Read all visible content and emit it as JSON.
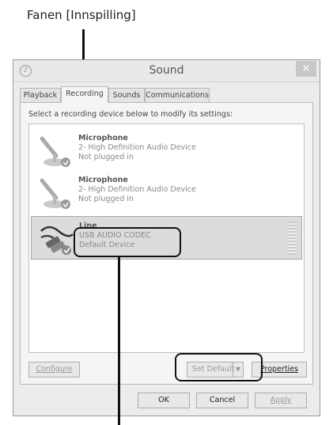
{
  "callout": {
    "tab_label": "Fanen [Innspilling]"
  },
  "window": {
    "title": "Sound",
    "close_glyph": "×"
  },
  "tabs": [
    {
      "label": "Playback"
    },
    {
      "label": "Recording"
    },
    {
      "label": "Sounds"
    },
    {
      "label": "Communications"
    }
  ],
  "instruction": "Select a recording device below to modify its settings:",
  "devices": [
    {
      "name": "Microphone",
      "line1": "2- High Definition Audio Device",
      "line2": "Not plugged in",
      "icon": "microphone-icon"
    },
    {
      "name": "Microphone",
      "line1": "2- High Definition Audio Device",
      "line2": "Not plugged in",
      "icon": "microphone-icon"
    },
    {
      "name": "Line",
      "line1": "USB AUDIO  CODEC",
      "line2": "Default Device",
      "icon": "line-in-cable-icon"
    }
  ],
  "buttons": {
    "configure": "Configure",
    "set_default": "Set Default",
    "properties": "Properties",
    "ok": "OK",
    "cancel": "Cancel",
    "apply": "Apply"
  }
}
